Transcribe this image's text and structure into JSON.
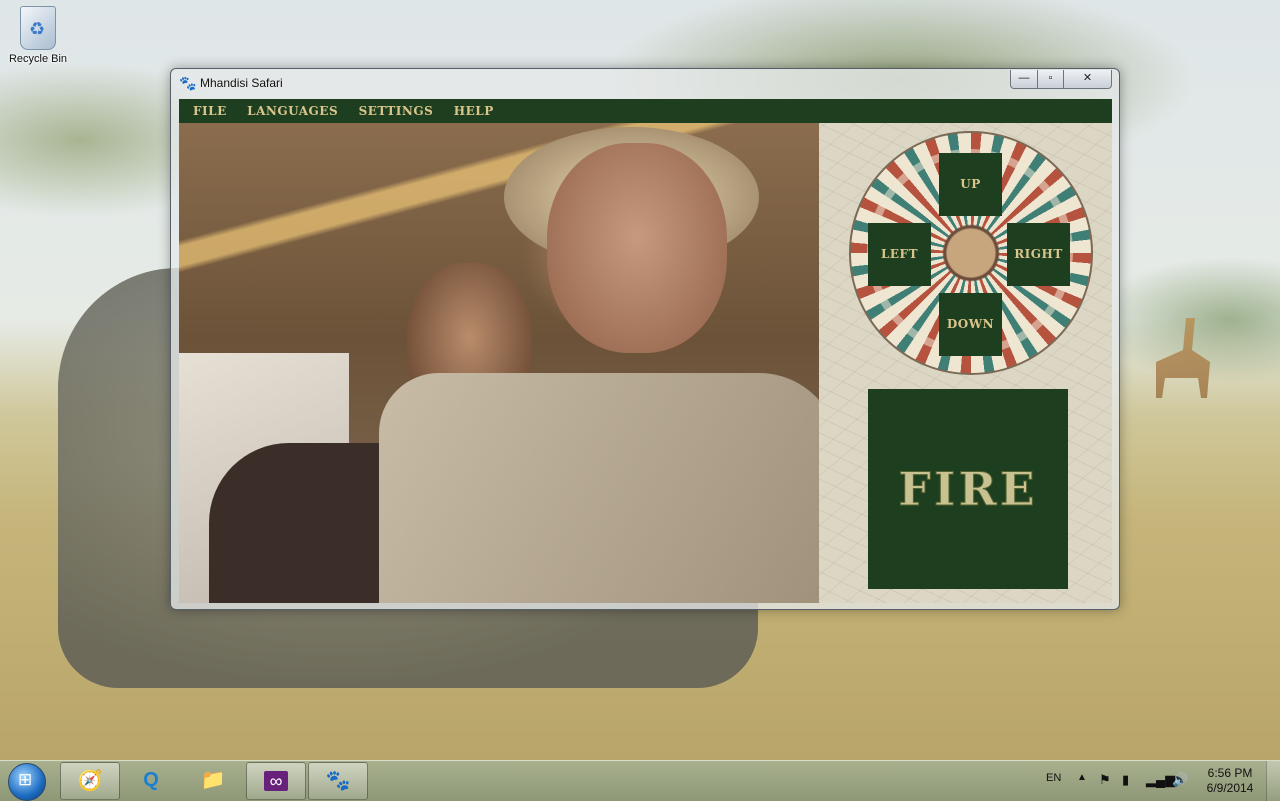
{
  "desktop": {
    "recycle_bin_label": "Recycle Bin"
  },
  "window": {
    "title": "Mhandisi Safari",
    "app_icon": "paw-icon",
    "controls": {
      "minimize": "—",
      "maximize": "▫",
      "close": "✕"
    }
  },
  "menu": {
    "file": "FILE",
    "languages": "LANGUAGES",
    "settings": "SETTINGS",
    "help": "HELP"
  },
  "controls": {
    "up": "UP",
    "left": "LEFT",
    "right": "RIGHT",
    "down": "DOWN",
    "fire": "FIRE"
  },
  "taskbar": {
    "items": [
      "safari-icon",
      "quicktime-icon",
      "file-explorer-icon",
      "visual-studio-icon",
      "mhandisi-safari-icon"
    ],
    "language": "EN",
    "time": "6:56 PM",
    "date": "6/9/2014"
  },
  "colors": {
    "menubar_bg": "#1d3f1f",
    "menu_text": "#d9c58c",
    "button_bg": "#1d3f1f"
  }
}
